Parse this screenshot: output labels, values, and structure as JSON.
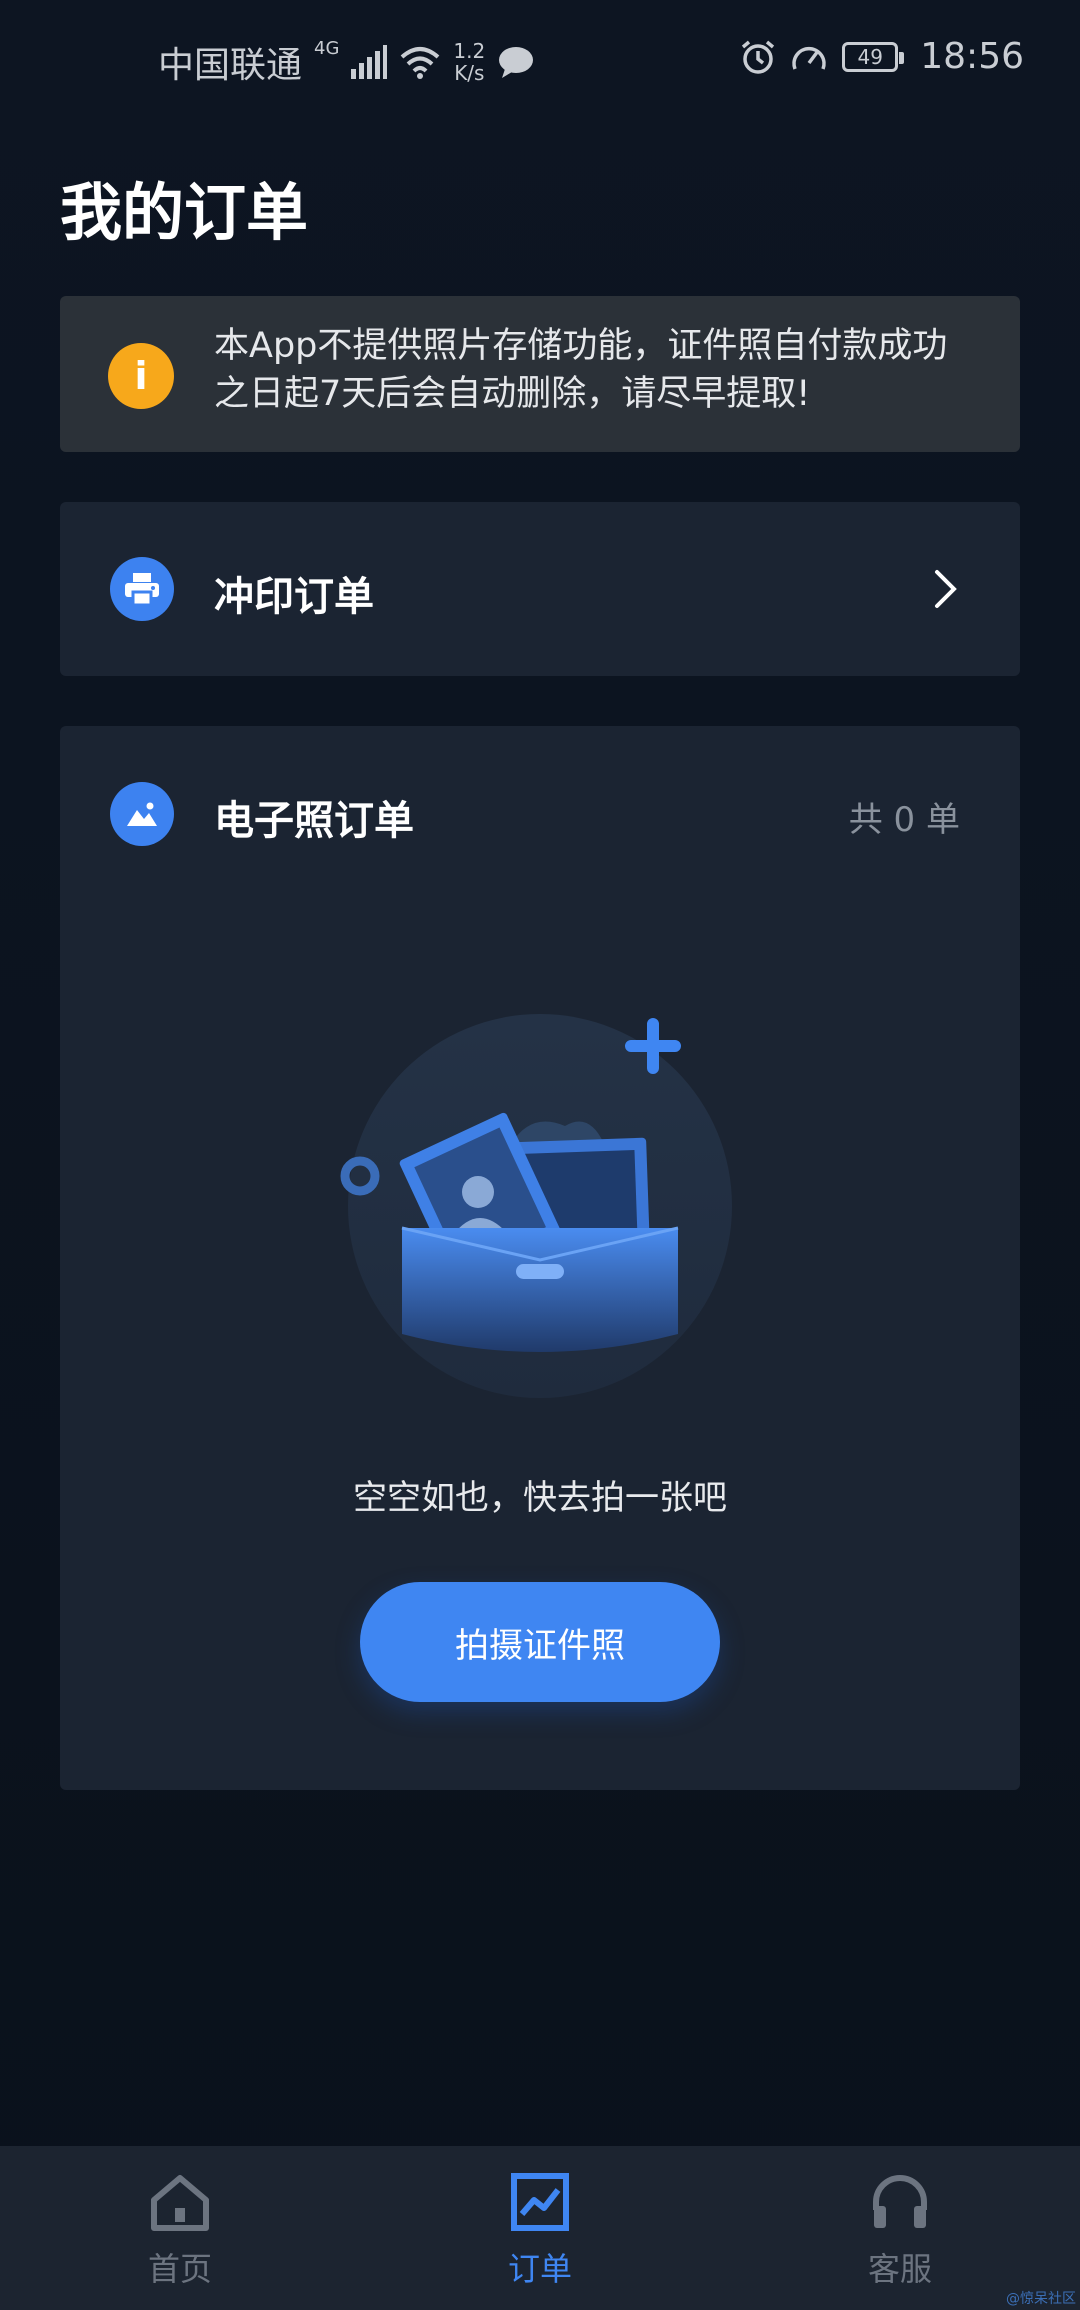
{
  "status_bar": {
    "carrier": "中国联通",
    "network": "4G",
    "speed_value": "1.2",
    "speed_unit": "K/s",
    "battery": "49",
    "time": "18:56"
  },
  "page": {
    "title": "我的订单"
  },
  "notice": {
    "icon": "info-icon",
    "icon_glyph": "i",
    "line1": "本App不提供照片存储功能，证件照自付款成功",
    "line2": "之日起7天后会自动删除，请尽早提取!",
    "icon_color": "#f7a81b"
  },
  "print_orders": {
    "icon": "printer-icon",
    "title": "冲印订单"
  },
  "ephoto_orders": {
    "icon": "image-icon",
    "title": "电子照订单",
    "count": "共 0 单",
    "empty_text": "空空如也，快去拍一张吧",
    "button_label": "拍摄证件照"
  },
  "bottom_nav": {
    "items": [
      {
        "label": "首页",
        "icon": "home-icon",
        "active": false
      },
      {
        "label": "订单",
        "icon": "orders-chart-icon",
        "active": true
      },
      {
        "label": "客服",
        "icon": "headset-icon",
        "active": false
      }
    ]
  },
  "watermark": "@惊呆社区",
  "colors": {
    "accent": "#3f86f2",
    "background": "#0c1420",
    "card": "#1b2432",
    "notice_bg": "#2b3138",
    "inactive": "#6c7480"
  }
}
